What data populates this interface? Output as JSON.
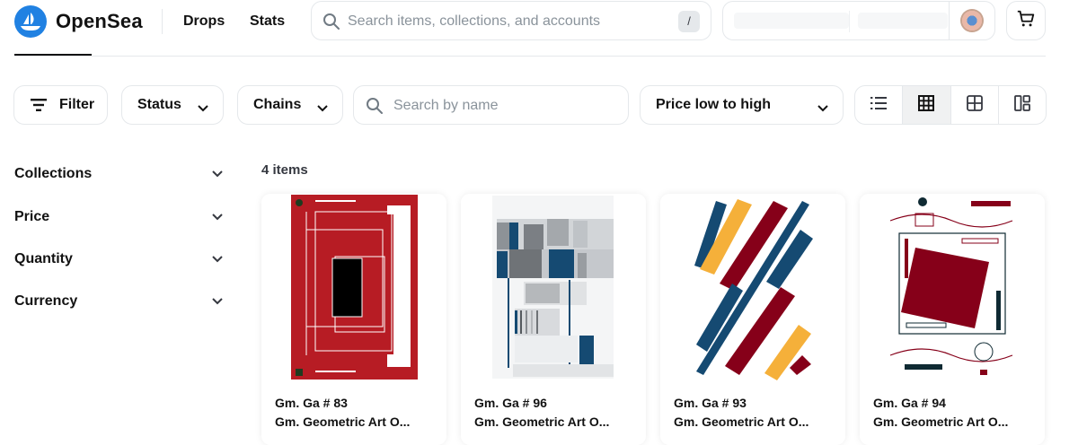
{
  "header": {
    "logo_text": "OpenSea",
    "nav": [
      "Drops",
      "Stats"
    ],
    "search_placeholder": "Search items, collections, and accounts",
    "search_shortcut": "/"
  },
  "toolbar": {
    "filter_label": "Filter",
    "status_label": "Status",
    "chains_label": "Chains",
    "name_search_placeholder": "Search by name",
    "sort_label": "Price low to high",
    "view_modes": [
      "list-view",
      "grid-large-view",
      "grid-small-view",
      "mosaic-view"
    ],
    "active_view": "grid-large-view"
  },
  "sidebar": {
    "items": [
      {
        "label": "Collections"
      },
      {
        "label": "Price"
      },
      {
        "label": "Quantity"
      },
      {
        "label": "Currency"
      }
    ]
  },
  "results": {
    "count_label": "4 items",
    "items": [
      {
        "name": "Gm. Ga # 83",
        "collection": "Gm. Geometric Art O..."
      },
      {
        "name": "Gm. Ga # 96",
        "collection": "Gm. Geometric Art O..."
      },
      {
        "name": "Gm. Ga # 93",
        "collection": "Gm. Geometric Art O..."
      },
      {
        "name": "Gm. Ga # 94",
        "collection": "Gm. Geometric Art O..."
      }
    ]
  },
  "colors": {
    "brand": "#2081e2",
    "art_red": "#b71c24",
    "art_maroon": "#860019",
    "art_navy": "#154a72",
    "art_yellow": "#f5b03a"
  }
}
